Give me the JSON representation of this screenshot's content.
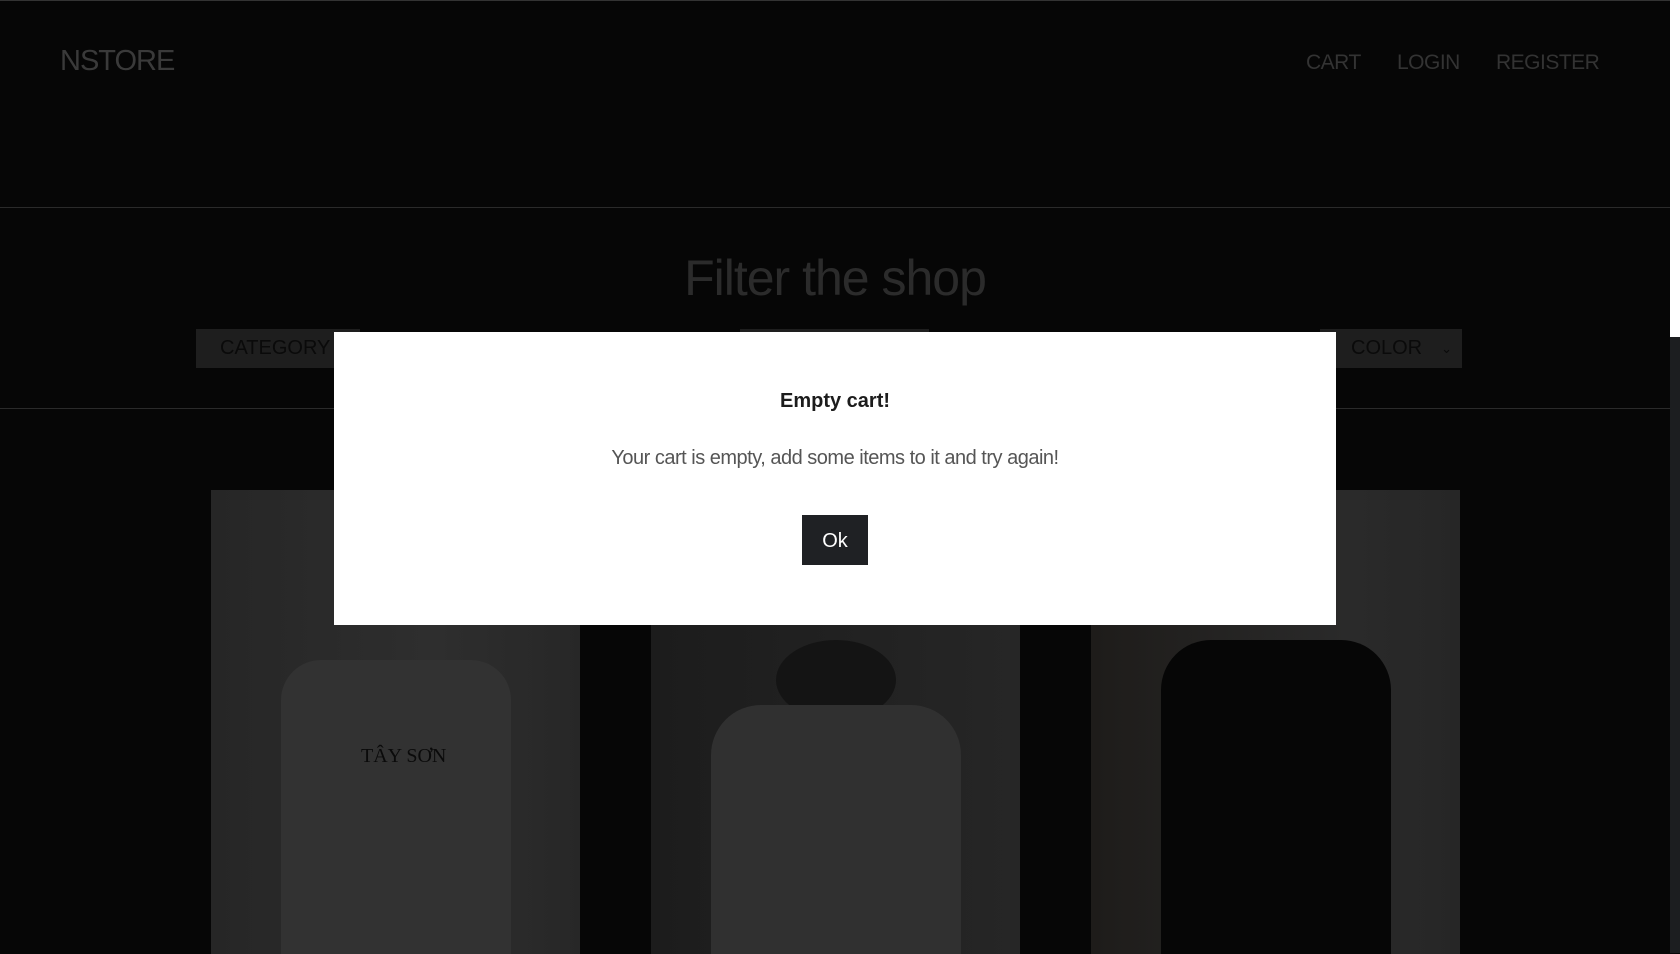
{
  "header": {
    "logo": "NSTORE",
    "nav": [
      "CART",
      "LOGIN",
      "REGISTER"
    ]
  },
  "filter": {
    "title": "Filter the shop",
    "selects": [
      {
        "name": "category",
        "value": "CATEGORY"
      },
      {
        "name": "size",
        "value": ""
      },
      {
        "name": "color",
        "value": "COLOR"
      }
    ]
  },
  "products": [
    {
      "shirt_color": "#2b2b2b",
      "print_text": "TÂY SƠN"
    },
    {
      "shirt_color": "#2b2b2b"
    },
    {
      "shirt_color": "#050505"
    }
  ],
  "modal": {
    "title": "Empty cart!",
    "message": "Your cart is empty, add some items to it and try again!",
    "ok_label": "Ok"
  },
  "colors": {
    "background": "#060606",
    "modal": "#ffffff",
    "button": "#1f2124"
  }
}
